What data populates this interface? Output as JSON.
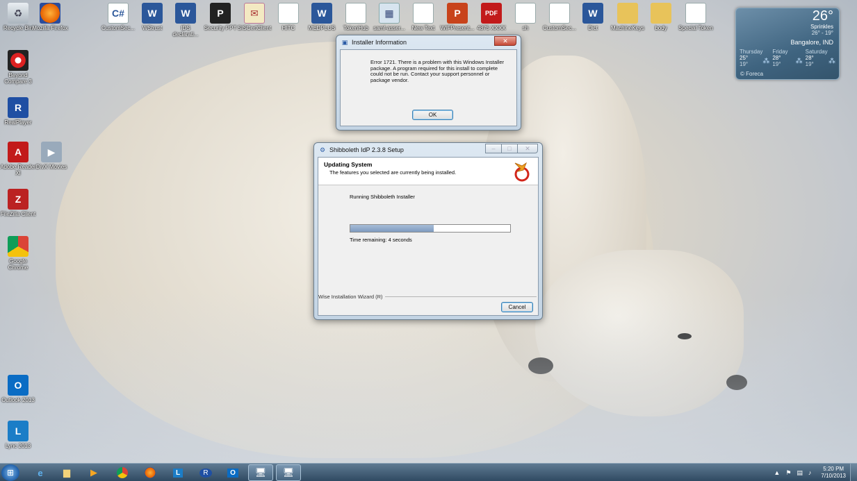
{
  "desktop_icons": [
    {
      "id": "recycle-bin",
      "label": "Recycle Bin",
      "glyph": "♻"
    },
    {
      "id": "firefox",
      "label": "Mozilla Firefox",
      "glyph": ""
    },
    {
      "id": "beyond-compare",
      "label": "Beyond Compare 3",
      "glyph": ""
    },
    {
      "id": "realplayer",
      "label": "RealPlayer",
      "glyph": "R"
    },
    {
      "id": "adobe-reader",
      "label": "Adobe Reader XI",
      "glyph": "A"
    },
    {
      "id": "divx-movies",
      "label": "DivX Movies",
      "glyph": "▶"
    },
    {
      "id": "filezilla",
      "label": "FileZilla Client",
      "glyph": "Z"
    },
    {
      "id": "google-chrome",
      "label": "Google Chrome",
      "glyph": ""
    },
    {
      "id": "outlook-2013",
      "label": "Outlook 2013",
      "glyph": "O"
    },
    {
      "id": "lync-2013",
      "label": "Lync 2013",
      "glyph": "L"
    },
    {
      "id": "customsec-cs",
      "label": "CustomSec...",
      "glyph": "C#"
    },
    {
      "id": "wstrust",
      "label": "WStrust",
      "glyph": "W"
    },
    {
      "id": "ids-declarati",
      "label": "IDS declarati...",
      "glyph": "W"
    },
    {
      "id": "security-ppt",
      "label": "Security PPT",
      "glyph": "P"
    },
    {
      "id": "siscertclient",
      "label": "SISCertClient",
      "glyph": "✉"
    },
    {
      "id": "hitc",
      "label": "HITC",
      "glyph": ""
    },
    {
      "id": "medplus",
      "label": "MEDPLUS",
      "glyph": "W"
    },
    {
      "id": "tokenhub",
      "label": "TokenHub",
      "glyph": ""
    },
    {
      "id": "saml-assert",
      "label": "saml-asser...",
      "glyph": "▦"
    },
    {
      "id": "new-text",
      "label": "New Text",
      "glyph": ""
    },
    {
      "id": "wifpresent",
      "label": "WIFPresent...",
      "glyph": "P"
    },
    {
      "id": "pdf-xxxx",
      "label": "4875 XXXX",
      "glyph": "PDF"
    },
    {
      "id": "sh",
      "label": "sh",
      "glyph": ""
    },
    {
      "id": "customsec-2",
      "label": "CustomSec...",
      "glyph": ""
    },
    {
      "id": "dict",
      "label": "Dict",
      "glyph": "W"
    },
    {
      "id": "machinekeys",
      "label": "MachineKeys",
      "glyph": ""
    },
    {
      "id": "body",
      "label": "body",
      "glyph": ""
    },
    {
      "id": "special-token",
      "label": "Special Token",
      "glyph": ""
    }
  ],
  "weather": {
    "temp": "26°",
    "condition": "Sprinkles",
    "range": "26° - 19°",
    "location": "Bangalore, IND",
    "days": [
      {
        "name": "Thursday",
        "hi": "25°",
        "lo": "19°"
      },
      {
        "name": "Friday",
        "hi": "28°",
        "lo": "19°"
      },
      {
        "name": "Saturday",
        "hi": "28°",
        "lo": "19°"
      }
    ],
    "source": "© Foreca"
  },
  "error_dialog": {
    "title": "Installer Information",
    "message": "Error 1721. There is a problem with this Windows Installer package. A program required for this install to complete could not be run. Contact your support personnel or package vendor.",
    "ok_label": "OK"
  },
  "setup_window": {
    "title": "Shibboleth IdP 2.3.8 Setup",
    "header_title": "Updating System",
    "header_subtitle": "The features you selected are currently being installed.",
    "status": "Running Shibboleth Installer",
    "progress_percent": 52,
    "time_remaining": "Time remaining: 4 seconds",
    "wizard_label": "Wise Installation Wizard (R)",
    "cancel_label": "Cancel"
  },
  "taskbar": {
    "clock_time": "5:20 PM",
    "clock_date": "7/10/2013"
  }
}
